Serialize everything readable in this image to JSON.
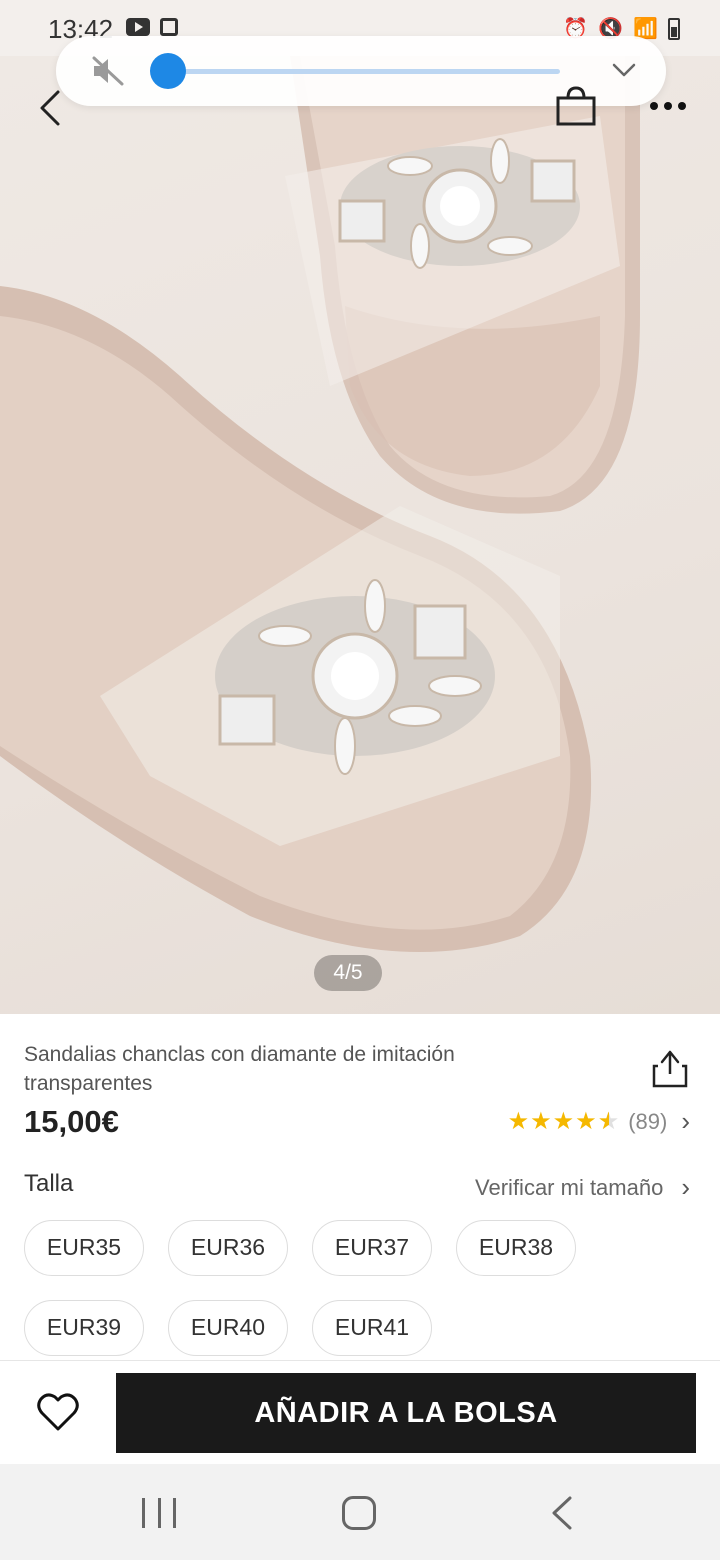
{
  "status_bar": {
    "time": "13:42"
  },
  "overlay": {
    "volume_level": 0.0
  },
  "gallery": {
    "indicator": "4/5"
  },
  "product": {
    "title": "Sandalias chanclas con diamante de imitación transparentes",
    "price": "15,00€",
    "rating_stars": 4.5,
    "rating_count": "(89)"
  },
  "size_section": {
    "label": "Talla",
    "check_link": "Verificar mi tamaño",
    "sizes": [
      "EUR35",
      "EUR36",
      "EUR37",
      "EUR38",
      "EUR39",
      "EUR40",
      "EUR41"
    ]
  },
  "actions": {
    "add_to_bag": "AÑADIR A LA BOLSA"
  },
  "colors": {
    "accent": "#1e88e5",
    "button": "#1a1a1a",
    "star": "#f5b800"
  }
}
